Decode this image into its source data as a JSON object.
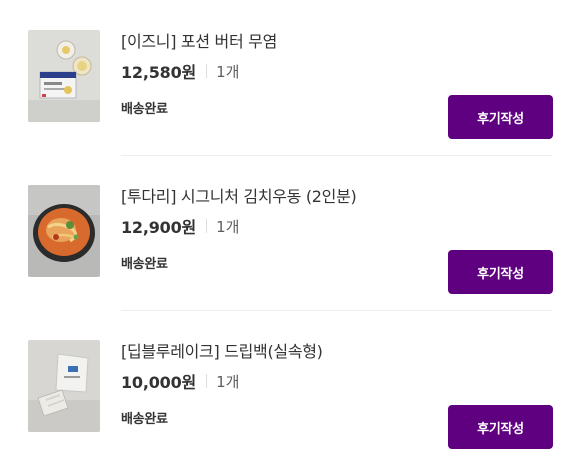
{
  "orders": [
    {
      "name": "[이즈니] 포션 버터 무염",
      "price": "12,580원",
      "quantity": "1개",
      "status": "배송완료",
      "review_label": "후기작성"
    },
    {
      "name": "[투다리] 시그니처 김치우동 (2인분)",
      "price": "12,900원",
      "quantity": "1개",
      "status": "배송완료",
      "review_label": "후기작성"
    },
    {
      "name": "[딥블루레이크] 드립백(실속형)",
      "price": "10,000원",
      "quantity": "1개",
      "status": "배송완료",
      "review_label": "후기작성"
    }
  ],
  "colors": {
    "accent": "#5f0080",
    "text": "#333333",
    "subtext": "#5f5f5f",
    "separator": "#eeeeee"
  }
}
